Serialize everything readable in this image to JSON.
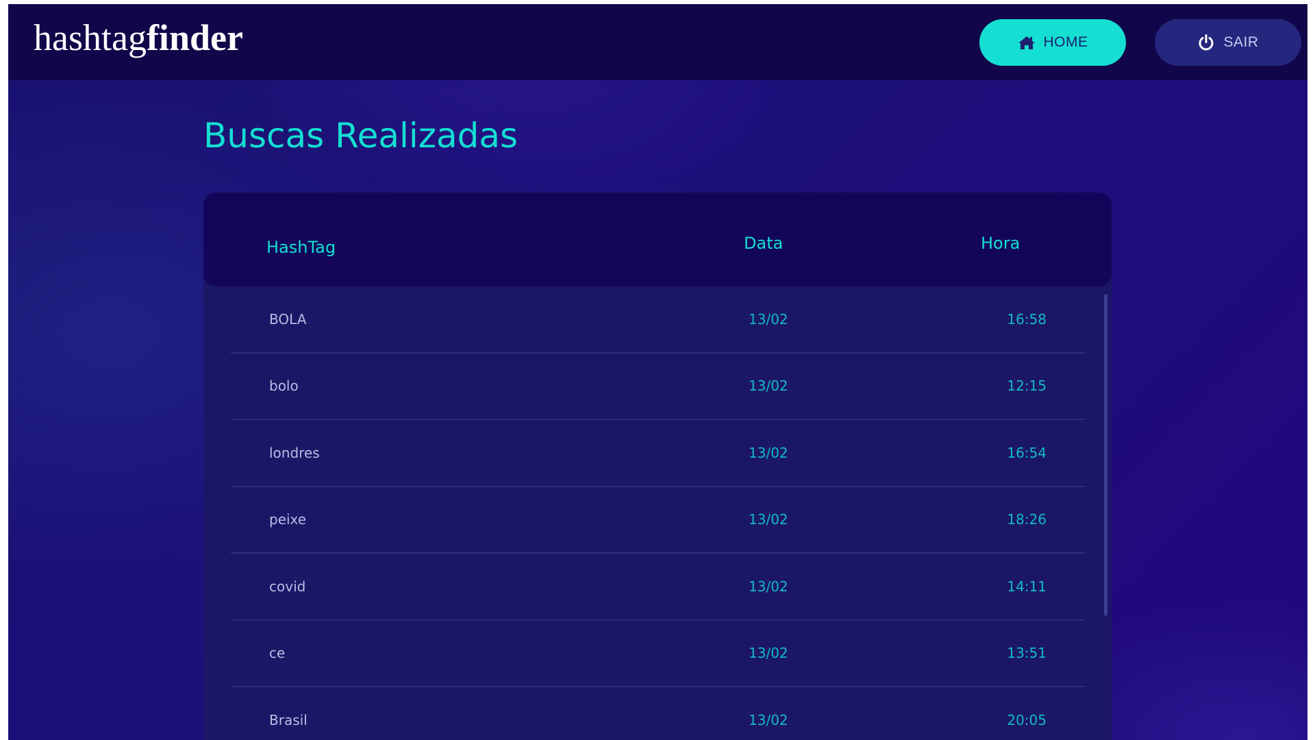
{
  "brand": {
    "regular": "hashtag",
    "bold": "finder"
  },
  "nav": {
    "home_label": "HOME",
    "sair_label": "SAIR",
    "home_icon": "home-icon",
    "sair_icon": "power-icon"
  },
  "page": {
    "title": "Buscas Realizadas"
  },
  "table": {
    "headers": {
      "hashtag": "HashTag",
      "data": "Data",
      "hora": "Hora"
    },
    "rows": [
      {
        "hashtag": "BOLA",
        "data": "13/02",
        "hora": "16:58"
      },
      {
        "hashtag": "bolo",
        "data": "13/02",
        "hora": "12:15"
      },
      {
        "hashtag": "londres",
        "data": "13/02",
        "hora": "16:54"
      },
      {
        "hashtag": "peixe",
        "data": "13/02",
        "hora": "18:26"
      },
      {
        "hashtag": "covid",
        "data": "13/02",
        "hora": "14:11"
      },
      {
        "hashtag": "ce",
        "data": "13/02",
        "hora": "13:51"
      },
      {
        "hashtag": "Brasil",
        "data": "13/02",
        "hora": "20:05"
      }
    ]
  },
  "colors": {
    "accent": "#14dfd2",
    "navbar": "#12064a",
    "background": "#1d0f7a",
    "table_body": "#1b1766",
    "table_head": "#13065a",
    "sair_button": "#23277e"
  }
}
